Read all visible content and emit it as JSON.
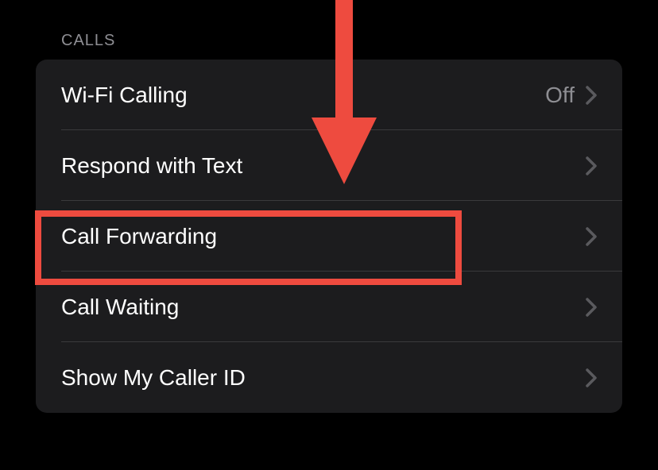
{
  "section": {
    "header": "CALLS"
  },
  "rows": [
    {
      "label": "Wi-Fi Calling",
      "value": "Off"
    },
    {
      "label": "Respond with Text",
      "value": ""
    },
    {
      "label": "Call Forwarding",
      "value": ""
    },
    {
      "label": "Call Waiting",
      "value": ""
    },
    {
      "label": "Show My Caller ID",
      "value": ""
    }
  ],
  "annotation": {
    "highlight_color": "#ee4b3f",
    "arrow_color": "#ee4b3f"
  }
}
